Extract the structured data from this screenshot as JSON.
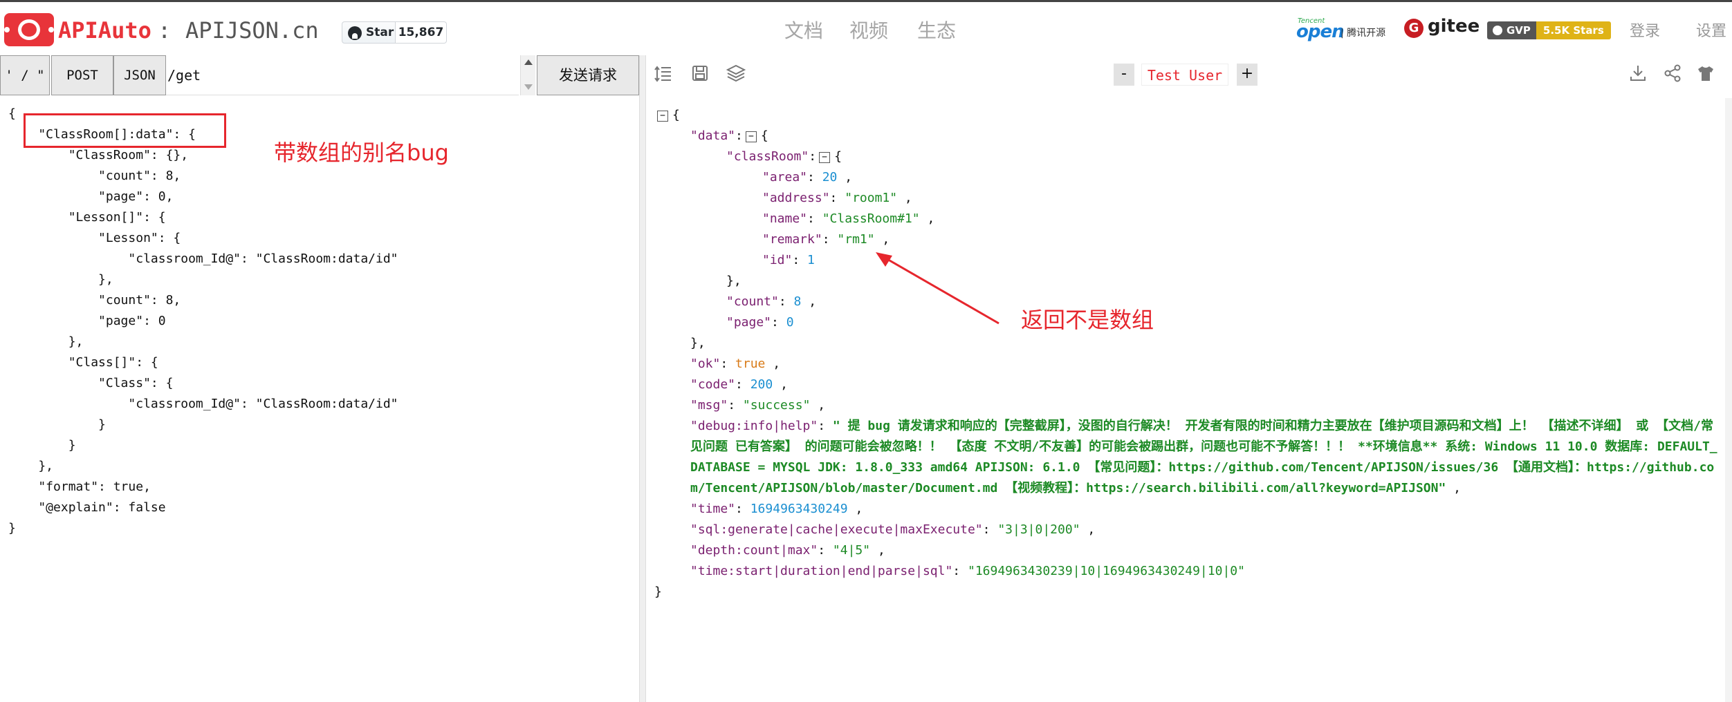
{
  "header": {
    "brand": "APIAuto",
    "colon": ":",
    "site": "APIJSON.cn",
    "star_label": "Star",
    "star_count": "15,867",
    "nav": [
      "文档",
      "视频",
      "生态"
    ],
    "tencent_label": "Tencent",
    "open_label": "open",
    "tencent_open_text": "| 腾讯开源",
    "gitee_label": "gitee",
    "gvp_label": "GVP",
    "gvp_stars": "5.5K Stars",
    "login": "登录",
    "settings": "设置",
    "brand_color": "#e8343a"
  },
  "request": {
    "mode_button": "' / \"",
    "method_button": "POST",
    "type_button": "JSON",
    "url": "/get",
    "send_button": "发送请求",
    "body_lines": [
      "{",
      "    \"ClassRoom[]:data\": {",
      "        \"ClassRoom\": {},",
      "            \"count\": 8,",
      "            \"page\": 0,",
      "        \"Lesson[]\": {",
      "            \"Lesson\": {",
      "                \"classroom_Id@\": \"ClassRoom:data/id\"",
      "            },",
      "            \"count\": 8,",
      "            \"page\": 0",
      "        },",
      "        \"Class[]\": {",
      "            \"Class\": {",
      "                \"classroom_Id@\": \"ClassRoom:data/id\"",
      "            }",
      "        }",
      "    },",
      "    \"format\": true,",
      "    \"@explain\": false",
      "}"
    ]
  },
  "annotations": {
    "left": "带数组的别名bug",
    "right": "返回不是数组",
    "color": "#e6262d"
  },
  "user": {
    "minus": "-",
    "name": "Test User",
    "plus": "+"
  },
  "response": {
    "open_brace": "{",
    "data_key": "\"data\"",
    "classroom_key": "\"classRoom\"",
    "area_key": "\"area\"",
    "area_val": "20",
    "address_key": "\"address\"",
    "address_val": "\"room1\"",
    "name_key": "\"name\"",
    "name_val": "\"ClassRoom#1\"",
    "remark_key": "\"remark\"",
    "remark_val": "\"rm1\"",
    "id_key": "\"id\"",
    "id_val": "1",
    "count_key": "\"count\"",
    "count_val": "8",
    "page_key": "\"page\"",
    "page_val": "0",
    "ok_key": "\"ok\"",
    "ok_val": "true",
    "code_key": "\"code\"",
    "code_val": "200",
    "msg_key": "\"msg\"",
    "msg_val": "\"success\"",
    "debug_key": "\"debug:info|help\"",
    "debug_val": "\" 提 bug 请发请求和响应的【完整截屏】，没图的自行解决！ 开发者有限的时间和精力主要放在【维护项目源码和文档】上！ 【描述不详细】 或 【文档/常见问题 已有答案】 的问题可能会被忽略！！ 【态度 不文明/不友善】的可能会被踢出群，问题也可能不予解答！！！ **环境信息** 系统: Windows 11 10.0 数据库: DEFAULT_DATABASE = MYSQL JDK: 1.8.0_333 amd64 APIJSON: 6.1.0 【常见问题】：https://github.com/Tencent/APIJSON/issues/36 【通用文档】：https://github.com/Tencent/APIJSON/blob/master/Document.md 【视频教程】：https://search.bilibili.com/all?keyword=APIJSON\"",
    "time_key": "\"time\"",
    "time_val": "1694963430249",
    "sql_key": "\"sql:generate|cache|execute|maxExecute\"",
    "sql_val": "\"3|3|0|200\"",
    "depth_key": "\"depth:count|max\"",
    "depth_val": "\"4|5\"",
    "timing_key": "\"time:start|duration|end|parse|sql\"",
    "timing_val": "\"1694963430239|10|1694963430249|10|0\"",
    "close_brace": "}"
  },
  "colors": {
    "key": "#7a1f6f",
    "string": "#1d8a25",
    "number": "#1b8fd1",
    "boolean": "#d97b18"
  }
}
